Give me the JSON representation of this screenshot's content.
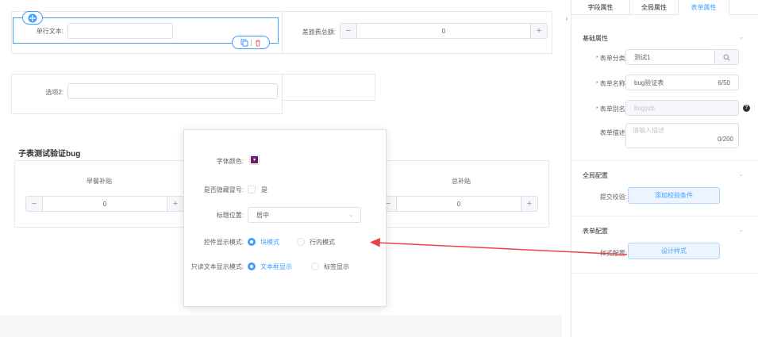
{
  "form": {
    "field1_label": "单行文本:",
    "field2_label": "差旅费总额:",
    "field2_value": "0",
    "field3_label": "选项2:",
    "subtable_title": "子表测试验证bug",
    "col1_header": "早餐补贴",
    "col1_value": "0",
    "col2_header": "总补贴",
    "col2_value": "0"
  },
  "popup": {
    "font_color_label": "字体颜色:",
    "hide_colon_label": "是否隐藏冒号:",
    "hide_colon_option": "是",
    "title_position_label": "标题位置:",
    "title_position_value": "居中",
    "display_mode_label": "控件显示模式:",
    "display_mode_options": [
      "块模式",
      "行内模式"
    ],
    "readonly_mode_label": "只读文本显示模式:",
    "readonly_mode_options": [
      "文本框显示",
      "标签显示"
    ],
    "font_color": "#6b1f64"
  },
  "panel": {
    "tabs": [
      "字段属性",
      "全局属性",
      "表单属性"
    ],
    "basic_section": "基础属性",
    "category_label": "表单分类:",
    "category_value": "测试1",
    "name_label": "表单名称:",
    "name_value": "bug验证表",
    "name_count": "6/50",
    "alias_label": "表单别名:",
    "alias_value": "bugyzb",
    "desc_label": "表单描述:",
    "desc_placeholder": "请输入描述",
    "desc_count": "0/200",
    "global_section": "全局配置",
    "submit_label": "提交校验:",
    "submit_button": "添加校验条件",
    "form_section": "表单配置",
    "style_label": "样式配置:",
    "style_button": "设计样式"
  },
  "colors": {
    "accent": "#409eff",
    "arrow": "#e8414a"
  }
}
